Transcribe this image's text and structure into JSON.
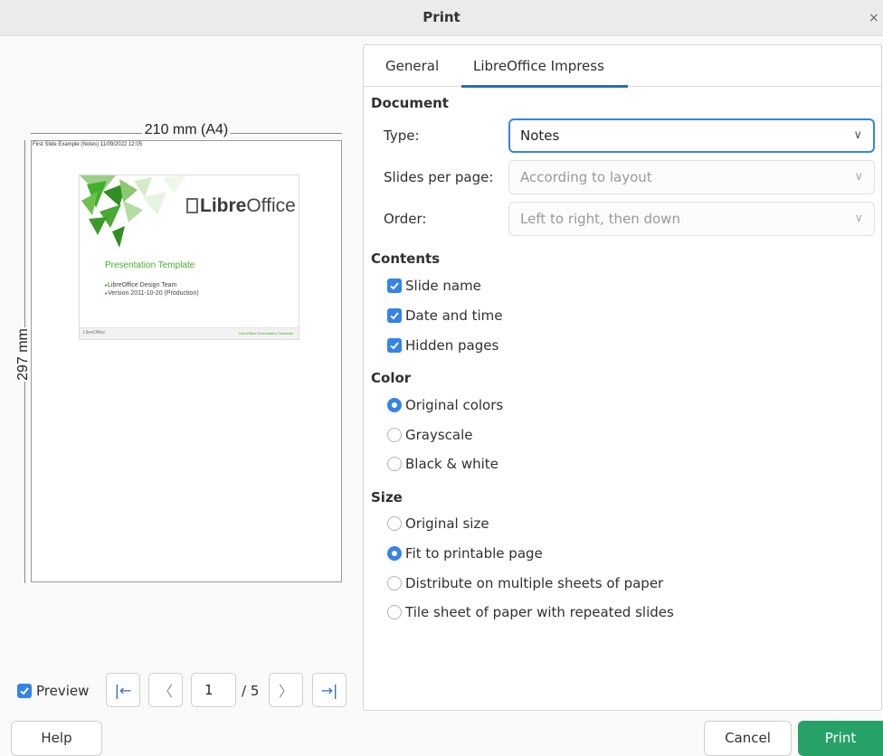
{
  "window": {
    "title": "Print",
    "close_glyph": "×"
  },
  "preview": {
    "width_label": "210 mm (A4)",
    "height_label": "297 mm",
    "page_header": "First Slide Example (Notes) 11/09/2022 12:05",
    "slide": {
      "logo_prefix": "Libre",
      "logo_suffix": "Office",
      "template_title": "Presentation Template",
      "bullets": [
        "LibreOffice Design Team",
        "Version 2011-10-20 (Production)"
      ],
      "footer_left": "LibreOffice",
      "footer_right": "LibreOffice Presentation Template",
      "accent_color": "#43b02a"
    },
    "preview_label": "Preview",
    "preview_checked": true,
    "current_page": "1",
    "page_total": "/ 5",
    "nav": {
      "first": "|←",
      "prev": "〈",
      "next": "〉",
      "last": "→|"
    }
  },
  "tabs": [
    {
      "label": "General",
      "active": false
    },
    {
      "label": "LibreOffice Impress",
      "active": true
    }
  ],
  "document": {
    "section": "Document",
    "type_label": "Type:",
    "type_value": "Notes",
    "slides_per_page_label": "Slides per page:",
    "slides_per_page_value": "According to layout",
    "order_label": "Order:",
    "order_value": "Left to right, then down"
  },
  "contents": {
    "section": "Contents",
    "items": [
      {
        "label": "Slide name",
        "checked": true
      },
      {
        "label": "Date and time",
        "checked": true
      },
      {
        "label": "Hidden pages",
        "checked": true
      }
    ]
  },
  "color": {
    "section": "Color",
    "options": [
      {
        "label": "Original colors",
        "selected": true
      },
      {
        "label": "Grayscale",
        "selected": false
      },
      {
        "label": "Black & white",
        "selected": false
      }
    ]
  },
  "size": {
    "section": "Size",
    "options": [
      {
        "label": "Original size",
        "selected": false
      },
      {
        "label": "Fit to printable page",
        "selected": true
      },
      {
        "label": "Distribute on multiple sheets of paper",
        "selected": false
      },
      {
        "label": "Tile sheet of paper with repeated slides",
        "selected": false
      }
    ]
  },
  "buttons": {
    "help": "Help",
    "cancel": "Cancel",
    "print": "Print"
  },
  "colors": {
    "accent": "#3584e4",
    "print_button": "#26a269"
  }
}
